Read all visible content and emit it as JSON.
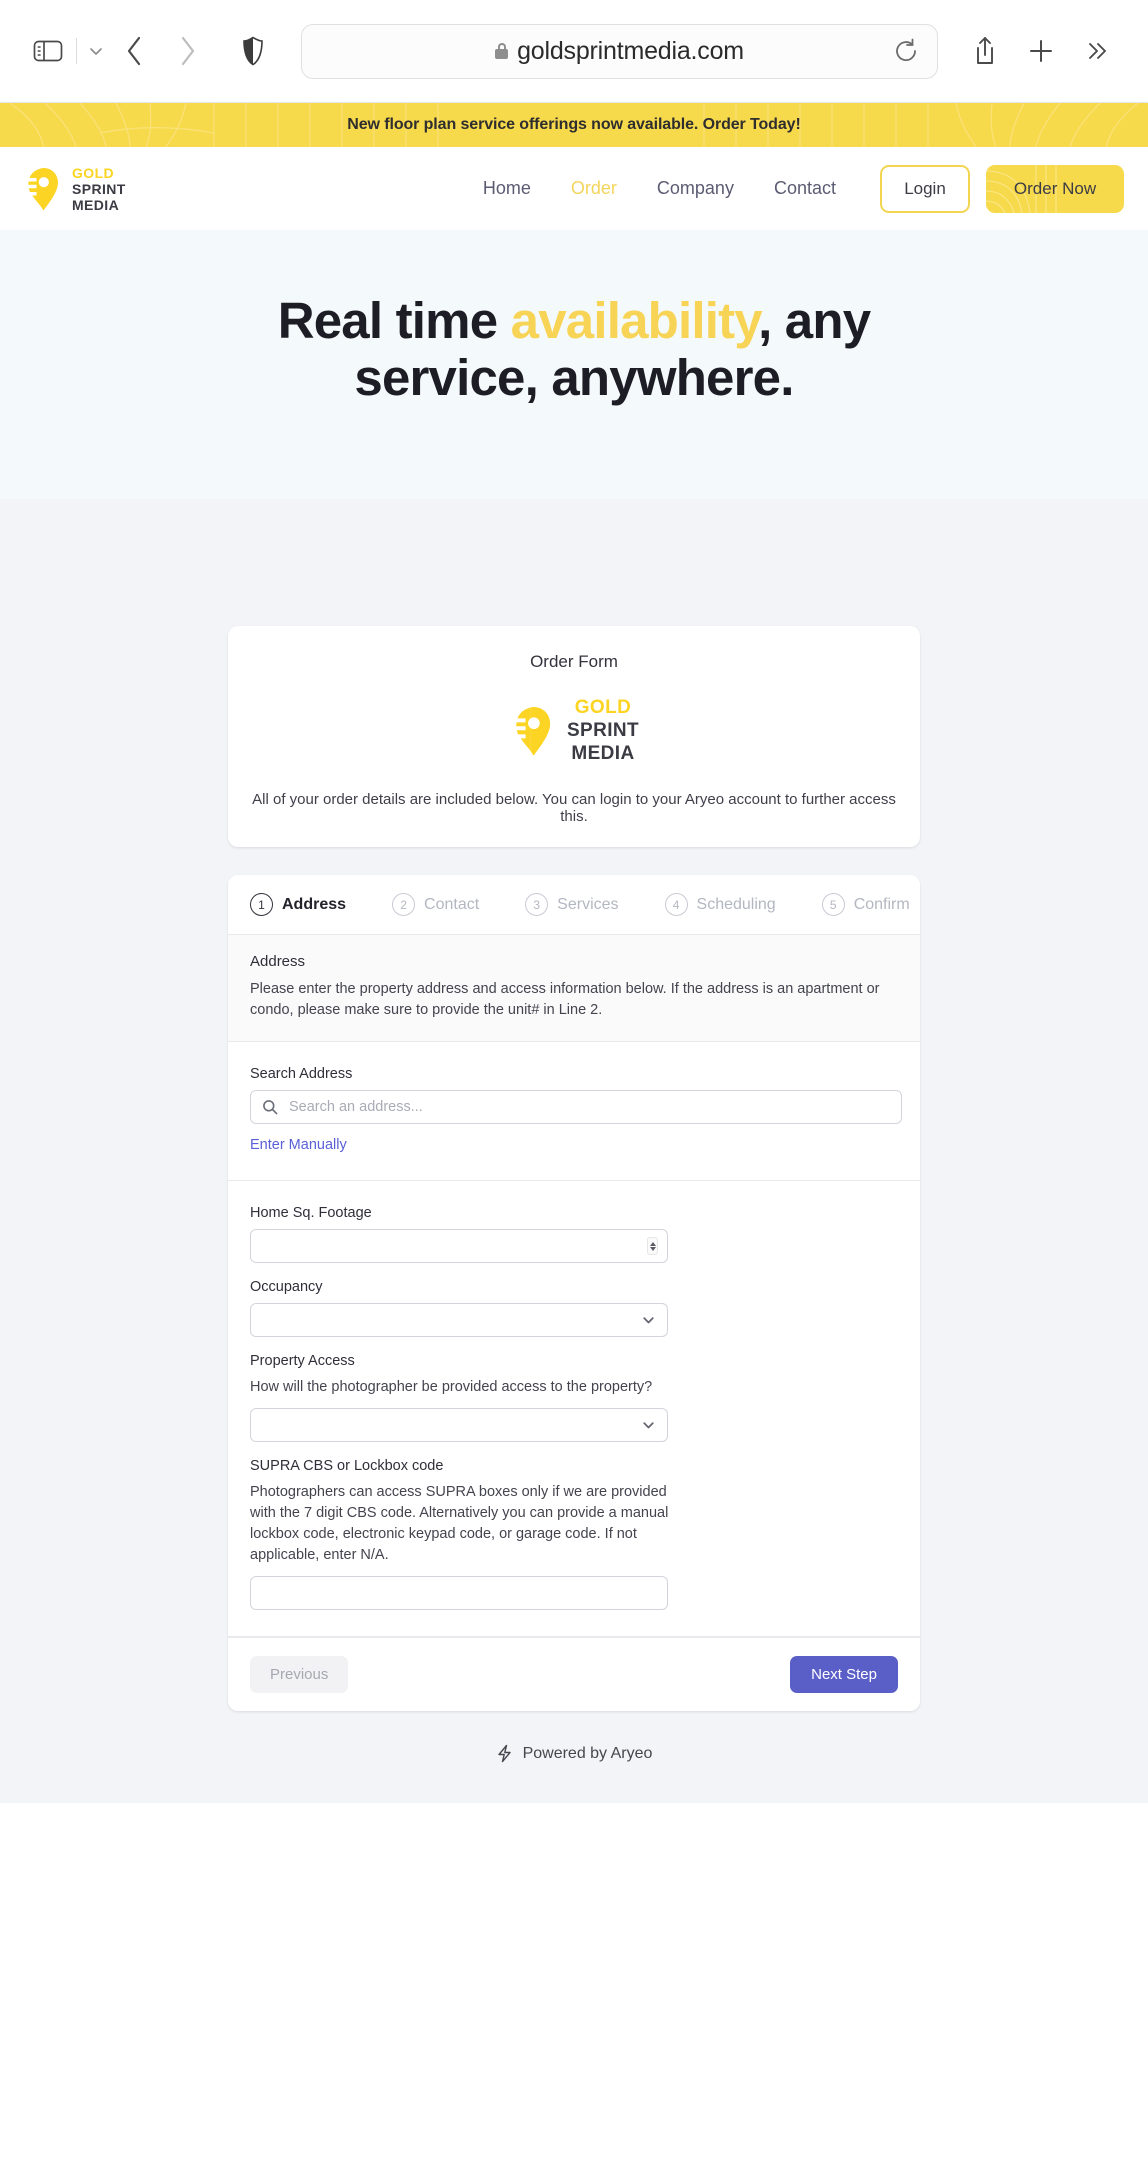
{
  "browser": {
    "url": "goldsprintmedia.com",
    "icons": {
      "sidebar": "sidebar-toggle-icon",
      "chevron": "chevron-down-icon",
      "back": "back-arrow-icon",
      "forward": "forward-arrow-icon",
      "shield": "shield-icon",
      "lock": "lock-icon",
      "reload": "reload-icon",
      "share": "share-icon",
      "new_tab": "plus-icon",
      "more": "chevron-double-right-icon"
    }
  },
  "announcement": {
    "text": "New floor plan service offerings now available. Order Today!"
  },
  "site_header": {
    "logo": {
      "gold": "GOLD",
      "sprint": "SPRINT",
      "media": "MEDIA"
    },
    "nav": [
      {
        "label": "Home",
        "active": false
      },
      {
        "label": "Order",
        "active": true
      },
      {
        "label": "Company",
        "active": false
      },
      {
        "label": "Contact",
        "active": false
      }
    ],
    "login_label": "Login",
    "order_label": "Order Now"
  },
  "hero": {
    "line1_pre": "Real time ",
    "line1_hl": "availability",
    "line1_post": ", any",
    "line2": "service, anywhere."
  },
  "order_card": {
    "title": "Order Form",
    "logo": {
      "gold": "GOLD",
      "sprint": "SPRINT",
      "media": "MEDIA"
    },
    "subtitle": "All of your order details are included below. You can login to your Aryeo account to further access this."
  },
  "wizard": {
    "steps": [
      {
        "num": "1",
        "label": "Address",
        "active": true
      },
      {
        "num": "2",
        "label": "Contact",
        "active": false
      },
      {
        "num": "3",
        "label": "Services",
        "active": false
      },
      {
        "num": "4",
        "label": "Scheduling",
        "active": false
      },
      {
        "num": "5",
        "label": "Confirm",
        "active": false
      }
    ],
    "section": {
      "heading": "Address",
      "description": "Please enter the property address and access information below. If the address is an apartment or condo, please make sure to provide the unit# in Line 2."
    },
    "search_address": {
      "label": "Search Address",
      "placeholder": "Search an address...",
      "value": "",
      "manual_link": "Enter Manually"
    },
    "fields": [
      {
        "label": "Home Sq. Footage",
        "type": "number",
        "value": "",
        "help": ""
      },
      {
        "label": "Occupancy",
        "type": "select",
        "value": "",
        "help": ""
      },
      {
        "label": "Property Access",
        "type": "select",
        "value": "",
        "help": "How will the photographer be provided access to the property?"
      },
      {
        "label": "SUPRA CBS or Lockbox code",
        "type": "text",
        "value": "",
        "help": "Photographers can access SUPRA boxes only if we are provided with the 7 digit CBS code. Alternatively you can provide a manual lockbox code, electronic keypad code, or garage code. If not applicable, enter N/A."
      }
    ],
    "previous_label": "Previous",
    "next_label": "Next Step"
  },
  "footer": {
    "powered_by": "Powered by Aryeo",
    "bolt_icon": "lightning-bolt-icon"
  },
  "colors": {
    "brand_yellow": "#f7d94c",
    "logo_yellow": "#fcd423",
    "accent_indigo": "#5a5fc7",
    "link_indigo": "#5a60d6",
    "hero_bg": "#f4f9fb",
    "page_bg": "#f3f4f7"
  }
}
